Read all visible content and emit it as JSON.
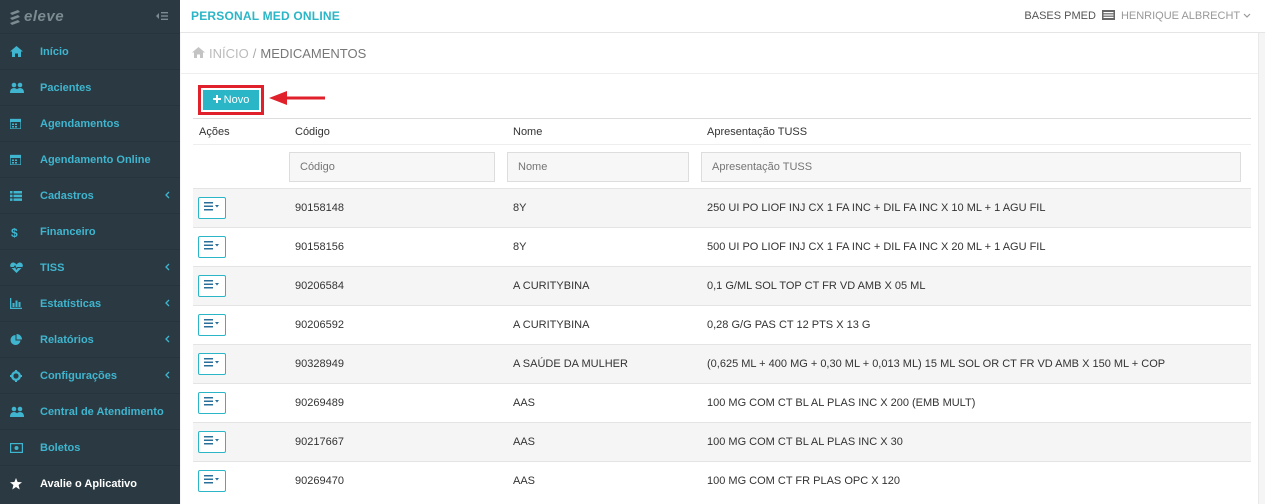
{
  "sidebar": {
    "logo_text": "eleve",
    "items": [
      {
        "label": "Início",
        "icon": "home-icon",
        "plain": false,
        "chevron": false
      },
      {
        "label": "Pacientes",
        "icon": "users-icon",
        "plain": false,
        "chevron": false
      },
      {
        "label": "Agendamentos",
        "icon": "calendar-icon",
        "plain": false,
        "chevron": false
      },
      {
        "label": "Agendamento Online",
        "icon": "calendar-icon",
        "plain": false,
        "chevron": false
      },
      {
        "label": "Cadastros",
        "icon": "list-icon",
        "plain": false,
        "chevron": true
      },
      {
        "label": "Financeiro",
        "icon": "dollar-icon",
        "plain": false,
        "chevron": false
      },
      {
        "label": "TISS",
        "icon": "heartbeat-icon",
        "plain": false,
        "chevron": true
      },
      {
        "label": "Estatísticas",
        "icon": "bar-chart-icon",
        "plain": false,
        "chevron": true
      },
      {
        "label": "Relatórios",
        "icon": "pie-chart-icon",
        "plain": false,
        "chevron": true
      },
      {
        "label": "Configurações",
        "icon": "gear-icon",
        "plain": false,
        "chevron": true
      },
      {
        "label": "Central de Atendimento",
        "icon": "users-icon",
        "plain": false,
        "chevron": false
      },
      {
        "label": "Boletos",
        "icon": "money-icon",
        "plain": false,
        "chevron": false
      },
      {
        "label": "Avalie o Aplicativo",
        "icon": "star-icon",
        "plain": true,
        "chevron": false
      }
    ]
  },
  "topbar": {
    "app_title": "PERSONAL MED ONLINE",
    "bases_label": "BASES PMED",
    "user_name": "HENRIQUE ALBRECHT"
  },
  "breadcrumb": {
    "home": "INÍCIO",
    "separator": "/",
    "current": "MEDICAMENTOS"
  },
  "toolbar": {
    "new_label": "Novo"
  },
  "table": {
    "headers": [
      "Ações",
      "Código",
      "Nome",
      "Apresentação TUSS"
    ],
    "filters": {
      "codigo_placeholder": "Código",
      "nome_placeholder": "Nome",
      "apresentacao_placeholder": "Apresentação TUSS"
    },
    "rows": [
      {
        "codigo": "90158148",
        "nome": "8Y",
        "apresentacao": "250 UI PO LIOF INJ CX 1 FA INC + DIL FA INC X 10 ML + 1 AGU FIL"
      },
      {
        "codigo": "90158156",
        "nome": "8Y",
        "apresentacao": "500 UI PO LIOF INJ CX 1 FA INC + DIL FA INC X 20 ML + 1 AGU FIL"
      },
      {
        "codigo": "90206584",
        "nome": "A CURITYBINA",
        "apresentacao": "0,1 G/ML SOL TOP CT FR VD AMB X 05 ML"
      },
      {
        "codigo": "90206592",
        "nome": "A CURITYBINA",
        "apresentacao": "0,28 G/G PAS CT 12 PTS X 13 G"
      },
      {
        "codigo": "90328949",
        "nome": "A SAÚDE DA MULHER",
        "apresentacao": "(0,625 ML + 400 MG + 0,30 ML + 0,013 ML) 15 ML SOL OR CT FR VD AMB X 150 ML + COP"
      },
      {
        "codigo": "90269489",
        "nome": "AAS",
        "apresentacao": "100 MG COM CT BL AL PLAS INC X 200 (EMB MULT)"
      },
      {
        "codigo": "90217667",
        "nome": "AAS",
        "apresentacao": "100 MG COM CT BL AL PLAS INC X 30"
      },
      {
        "codigo": "90269470",
        "nome": "AAS",
        "apresentacao": "100 MG COM CT FR PLAS OPC X 120"
      }
    ]
  },
  "colors": {
    "sidebar_bg": "#2b3a42",
    "accent": "#2ab6c6",
    "nav_text": "#3fb5cf",
    "highlight": "#e0202a"
  }
}
